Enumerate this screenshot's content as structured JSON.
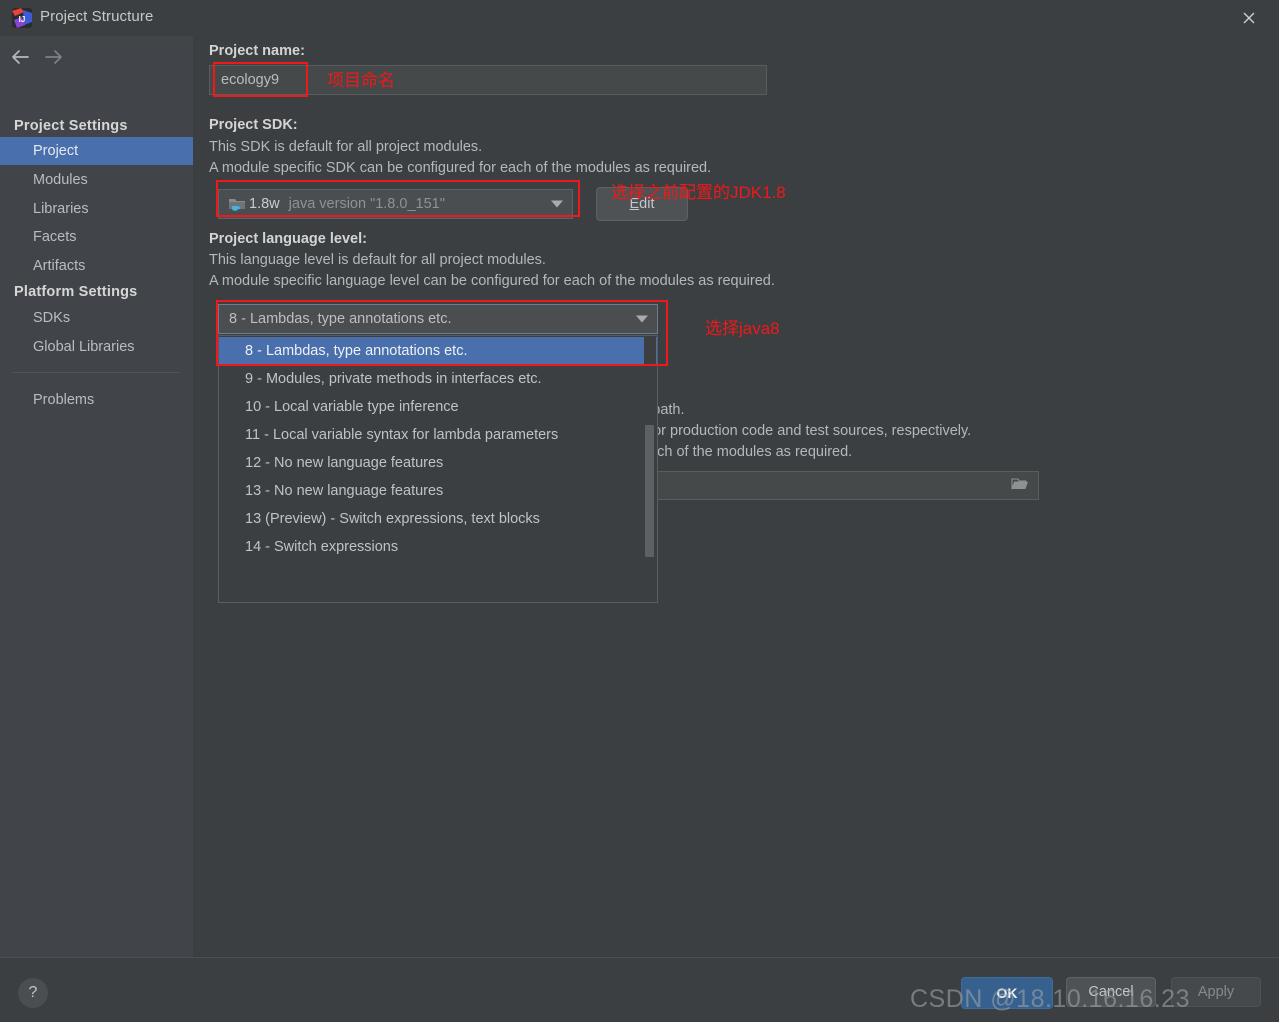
{
  "window": {
    "title": "Project Structure",
    "icon": "intellij-idea-icon",
    "close_icon": "close-icon"
  },
  "nav": {
    "back_icon": "arrow-left-icon",
    "forward_icon": "arrow-right-icon"
  },
  "sidebar": {
    "groups": [
      {
        "title": "Project Settings",
        "items": [
          {
            "label": "Project",
            "selected": true
          },
          {
            "label": "Modules",
            "selected": false
          },
          {
            "label": "Libraries",
            "selected": false
          },
          {
            "label": "Facets",
            "selected": false
          },
          {
            "label": "Artifacts",
            "selected": false
          }
        ]
      },
      {
        "title": "Platform Settings",
        "items": [
          {
            "label": "SDKs",
            "selected": false
          },
          {
            "label": "Global Libraries",
            "selected": false
          }
        ]
      }
    ],
    "problems": {
      "label": "Problems"
    }
  },
  "main": {
    "project_name": {
      "label": "Project name:",
      "value": "ecology9"
    },
    "project_sdk": {
      "label": "Project SDK:",
      "desc_line1": "This SDK is default for all project modules.",
      "desc_line2": "A module specific SDK can be configured for each of the modules as required.",
      "selected": "1.8w",
      "selected_detail": "java version \"1.8.0_151\"",
      "icon": "jdk-folder-icon",
      "edit_button": "Edit",
      "edit_button_mnemonic": "E"
    },
    "language_level": {
      "label": "Project language level:",
      "desc_line1": "This language level is default for all project modules.",
      "desc_line2": "A module specific language level can be configured for each of the modules as required.",
      "selected": "8 - Lambdas, type annotations etc.",
      "options": [
        "8 - Lambdas, type annotations etc.",
        "9 - Modules, private methods in interfaces etc.",
        "10 - Local variable type inference",
        "11 - Local variable syntax for lambda parameters",
        "12 - No new language features",
        "13 - No new language features",
        "13 (Preview) - Switch expressions, text blocks",
        "14 - Switch expressions"
      ]
    },
    "compiler_output": {
      "desc_line1_tail": "s path.",
      "desc_line2_tail": "t for production code and test sources, respectively.",
      "desc_line3_tail": "each of the modules as required.",
      "value": "",
      "browse_icon": "folder-browse-icon"
    }
  },
  "annotations": [
    {
      "text": "项目命名"
    },
    {
      "text": "选择之前配置的JDK1.8"
    },
    {
      "text": "选择java8"
    }
  ],
  "footer": {
    "help_icon": "question-mark-icon",
    "ok": "OK",
    "cancel": "Cancel",
    "apply": "Apply"
  },
  "watermark": {
    "text": "CSDN @18.10.16.16.23"
  },
  "colors": {
    "background": "#3c3f41",
    "sidebar": "#41454a",
    "selection": "#4a6fad",
    "ok_button": "#36618f",
    "annotation": "#f01818"
  }
}
